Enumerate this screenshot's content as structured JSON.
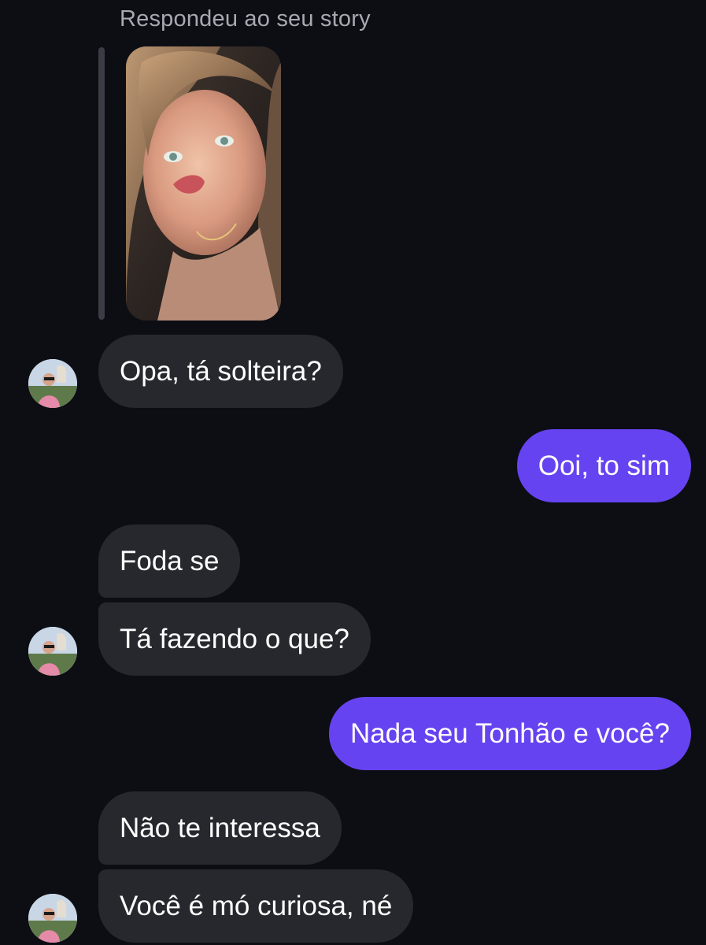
{
  "story": {
    "caption": "Respondeu ao seu story",
    "thumbnail": "story-photo"
  },
  "messages": [
    {
      "from": "them",
      "text": "Opa, tá solteira?",
      "avatar": true
    },
    {
      "from": "me",
      "text": "Ooi, to sim"
    },
    {
      "from": "them",
      "text": "Foda se",
      "avatar": false
    },
    {
      "from": "them",
      "text": "Tá fazendo o que?",
      "avatar": true
    },
    {
      "from": "me",
      "text": "Nada seu Tonhão e você?"
    },
    {
      "from": "them",
      "text": "Não te interessa",
      "avatar": false
    },
    {
      "from": "them",
      "text": "Você é mó curiosa, né",
      "avatar": true
    }
  ],
  "colors": {
    "background": "#0c0e14",
    "incoming_bubble": "#26282e",
    "outgoing_bubble": "#6643f0",
    "caption_text": "#a8aab2"
  }
}
